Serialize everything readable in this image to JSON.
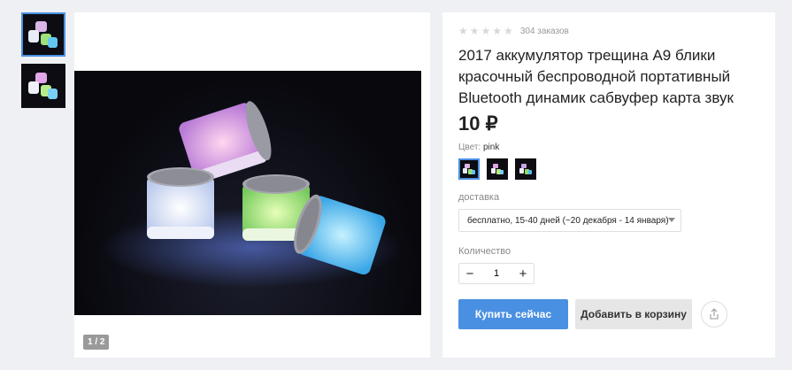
{
  "gallery": {
    "counter": "1 / 2",
    "thumbnail_count": 2
  },
  "product": {
    "rating_stars": 0,
    "orders": "304 заказов",
    "title": "2017 аккумулятор трещина А9 блики красочный беспроводной портативный Bluetooth динамик сабвуфер карта звук",
    "price": "10 ₽",
    "color_label": "Цвет:",
    "color_value": "pink",
    "delivery_label": "доставка",
    "delivery_value": "бесплатно, 15-40 дней (~20 декабря - 14 января)",
    "quantity_label": "Количество",
    "quantity_value": "1",
    "minus": "−",
    "plus": "+",
    "buy_label": "Купить сейчас",
    "cart_label": "Добавить в корзину"
  },
  "colors": {
    "accent": "#4a90e2"
  },
  "icons": {
    "share": "share-icon",
    "star": "star-icon",
    "dropdown": "chevron-down-icon"
  }
}
